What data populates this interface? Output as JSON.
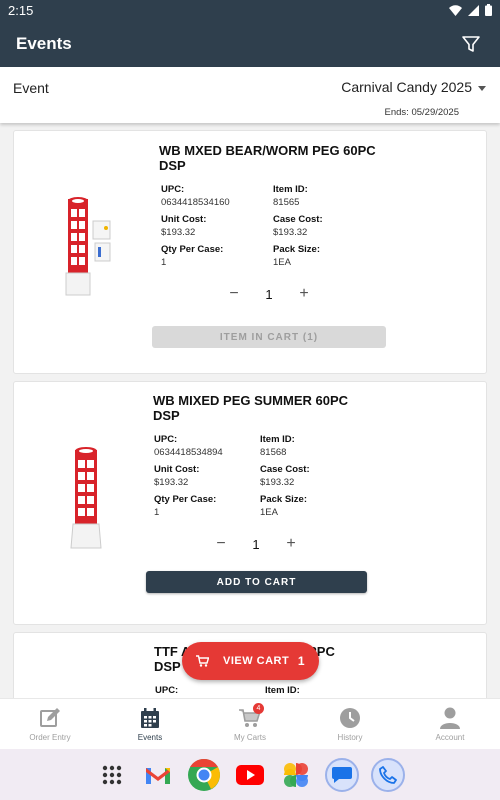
{
  "status": {
    "time": "2:15"
  },
  "appbar": {
    "title": "Events"
  },
  "event": {
    "label": "Event",
    "selected": "Carnival Candy 2025",
    "ends": "Ends: 05/29/2025"
  },
  "products": [
    {
      "name": "WB MXED BEAR/WORM PEG 60PC DSP",
      "upc_label": "UPC:",
      "upc": "0634418534160",
      "item_id_label": "Item ID:",
      "item_id": "81565",
      "unit_cost_label": "Unit Cost:",
      "unit_cost": "$193.32",
      "case_cost_label": "Case Cost:",
      "case_cost": "$193.32",
      "qty_case_label": "Qty Per Case:",
      "qty_case": "1",
      "pack_size_label": "Pack Size:",
      "pack_size": "1EA",
      "quantity": "1",
      "button": "ITEM IN CART (1)"
    },
    {
      "name": "WB MIXED PEG SUMMER 60PC DSP",
      "upc_label": "UPC:",
      "upc": "0634418534894",
      "item_id_label": "Item ID:",
      "item_id": "81568",
      "unit_cost_label": "Unit Cost:",
      "unit_cost": "$193.32",
      "case_cost_label": "Case Cost:",
      "case_cost": "$193.32",
      "qty_case_label": "Qty Per Case:",
      "qty_case": "1",
      "pack_size_label": "Pack Size:",
      "pack_size": "1EA",
      "quantity": "1",
      "button": "ADD TO CART"
    },
    {
      "name_start": "TTF A",
      "name_end": "32PC",
      "name_line2": "DSP",
      "upc_label": "UPC:",
      "item_id_label": "Item ID:"
    }
  ],
  "fab": {
    "label": "VIEW CART",
    "count": "1"
  },
  "nav": {
    "items": [
      {
        "label": "Order Entry",
        "icon": "edit-icon"
      },
      {
        "label": "Events",
        "icon": "calendar-icon"
      },
      {
        "label": "My Carts",
        "icon": "cart-icon",
        "badge": "4"
      },
      {
        "label": "History",
        "icon": "clock-icon"
      },
      {
        "label": "Account",
        "icon": "person-icon"
      }
    ]
  },
  "colors": {
    "primary": "#2f3f4d",
    "accent": "#e53935"
  }
}
